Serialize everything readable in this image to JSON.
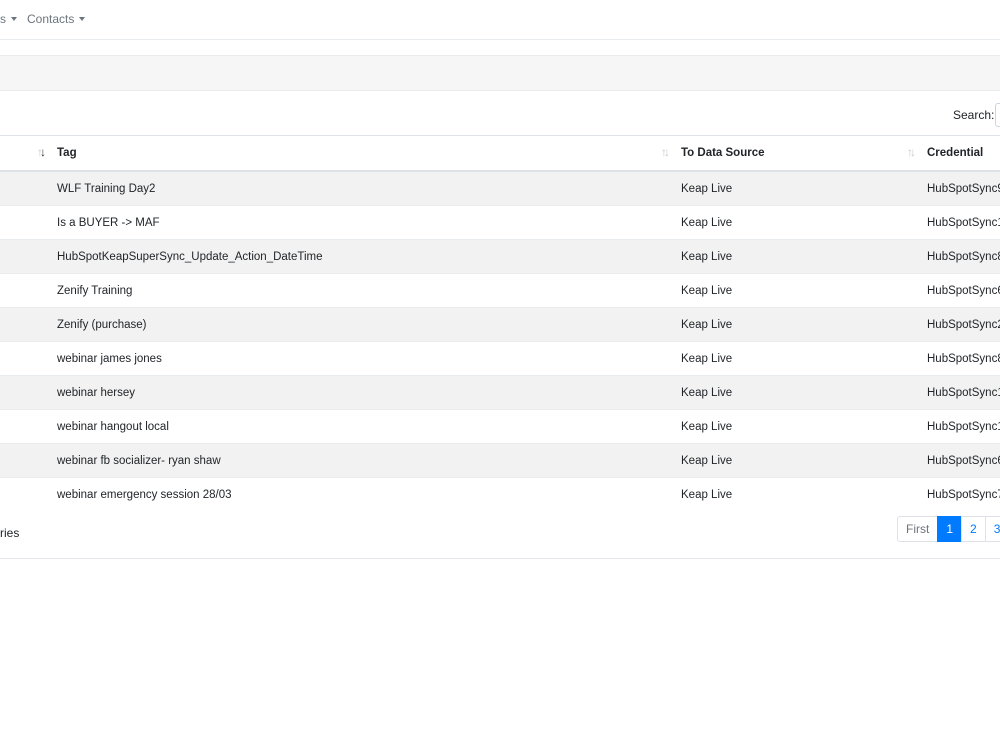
{
  "nav": {
    "items": [
      {
        "label": "s"
      },
      {
        "label": "Contacts"
      }
    ]
  },
  "search": {
    "label": "Search:",
    "placeholder": ""
  },
  "table": {
    "columns": [
      {
        "label": ""
      },
      {
        "label": "Tag"
      },
      {
        "label": "To Data Source"
      },
      {
        "label": "Credential"
      }
    ],
    "rows": [
      {
        "tag": "WLF Training Day2",
        "source": "Keap Live",
        "credential": "HubSpotSync9"
      },
      {
        "tag": "Is a BUYER -> MAF",
        "source": "Keap Live",
        "credential": "HubSpotSync1"
      },
      {
        "tag": "HubSpotKeapSuperSync_Update_Action_DateTime",
        "source": "Keap Live",
        "credential": "HubSpotSync8"
      },
      {
        "tag": "Zenify Training",
        "source": "Keap Live",
        "credential": "HubSpotSync6"
      },
      {
        "tag": "Zenify (purchase)",
        "source": "Keap Live",
        "credential": "HubSpotSync2"
      },
      {
        "tag": "webinar james jones",
        "source": "Keap Live",
        "credential": "HubSpotSync8"
      },
      {
        "tag": "webinar hersey",
        "source": "Keap Live",
        "credential": "HubSpotSync1"
      },
      {
        "tag": "webinar hangout local",
        "source": "Keap Live",
        "credential": "HubSpotSync1"
      },
      {
        "tag": "webinar fb socializer- ryan shaw",
        "source": "Keap Live",
        "credential": "HubSpotSync6"
      },
      {
        "tag": "webinar emergency session 28/03",
        "source": "Keap Live",
        "credential": "HubSpotSync7"
      }
    ]
  },
  "info_text": "ries",
  "pagination": {
    "first": "First",
    "pages": [
      "1",
      "2",
      "3"
    ],
    "active": "1"
  }
}
